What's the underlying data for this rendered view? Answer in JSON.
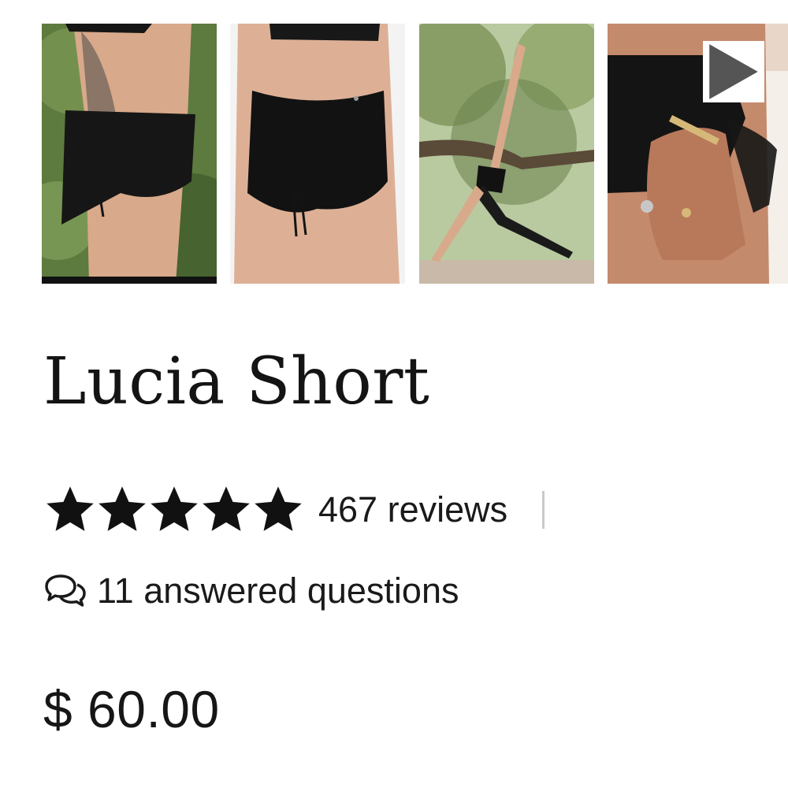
{
  "gallery": {
    "thumbnails": [
      {
        "description_icon": "product-photo-side-tattoo"
      },
      {
        "description_icon": "product-photo-front"
      },
      {
        "description_icon": "product-photo-yoga-pose"
      },
      {
        "description_icon": "product-video-closeup",
        "has_video": true
      }
    ]
  },
  "product": {
    "title": "Lucia Short",
    "rating": 5,
    "max_rating": 5,
    "reviews_label": "467 reviews",
    "questions_label": "11 answered questions",
    "price": "$ 60.00"
  },
  "colors": {
    "star": "#111111",
    "divider": "#c9c9c9",
    "text": "#1a1a1a"
  }
}
